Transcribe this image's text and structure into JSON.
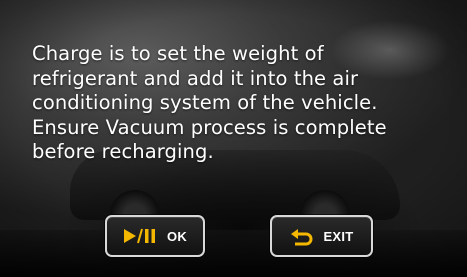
{
  "message": {
    "lines": [
      "Charge is to set the weight of",
      "refrigerant and add it into the air",
      "conditioning system of the vehicle.",
      "Ensure Vacuum process is complete",
      "before recharging."
    ]
  },
  "buttons": {
    "ok": {
      "label": "OK",
      "icon": "play-pause-icon"
    },
    "exit": {
      "label": "EXIT",
      "icon": "return-arrow-icon"
    }
  },
  "colors": {
    "accent": "#f5b800",
    "text": "#ffffff",
    "button_border": "#d9d9d9"
  }
}
